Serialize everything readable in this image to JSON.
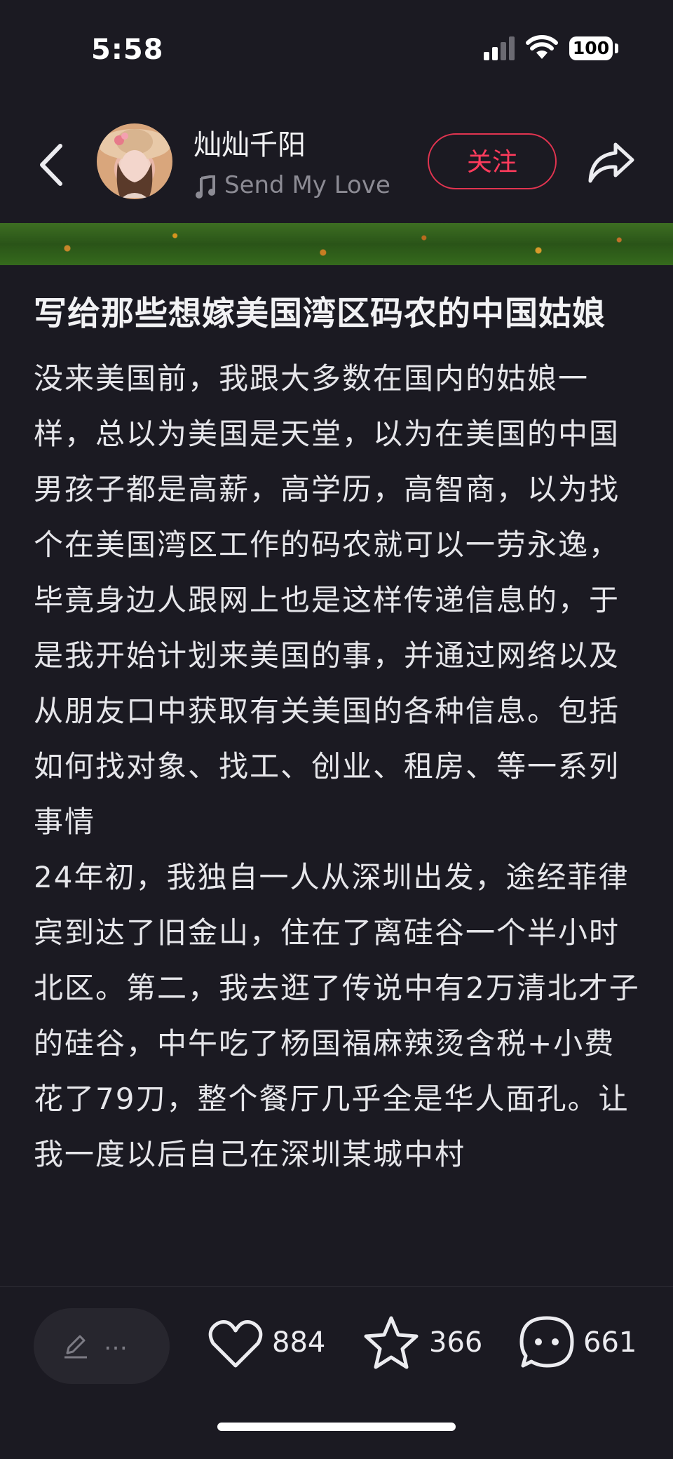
{
  "status": {
    "time": "5:58",
    "battery": "100"
  },
  "header": {
    "username": "灿灿千阳",
    "music_title": "Send My Love",
    "follow_label": "关注"
  },
  "article": {
    "title": "写给那些想嫁美国湾区码农的中国姑娘",
    "paragraphs": [
      "没来美国前，我跟大多数在国内的姑娘一样，总以为美国是天堂，以为在美国的中国男孩子都是高薪，高学历，高智商，以为找个在美国湾区工作的码农就可以一劳永逸，毕竟身边人跟网上也是这样传递信息的，于是我开始计划来美国的事，并通过网络以及从朋友口中获取有关美国的各种信息。包括如何找对象、找工、创业、租房、等一系列事情",
      "24年初，我独自一人从深圳出发，途经菲律宾到达了旧金山，住在了离硅谷一个半小时北区。第二，我去逛了传说中有2万清北才子的硅谷，中午吃了杨国福麻辣烫含税+小费花了79刀，整个餐厅几乎全是华人面孔。让我一度以后自己在深圳某城中村"
    ]
  },
  "actions": {
    "comment_placeholder": "…",
    "likes": "884",
    "favorites": "366",
    "comments": "661"
  },
  "colors": {
    "background": "#1b1a22",
    "accent": "#ff3b5c"
  }
}
